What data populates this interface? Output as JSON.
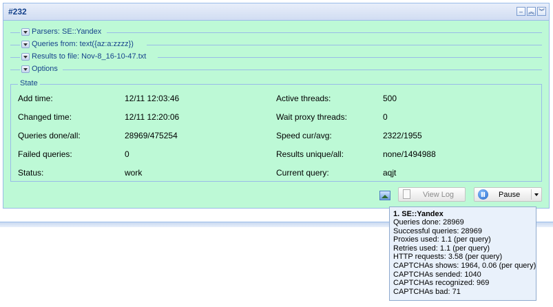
{
  "panel": {
    "title": "#232"
  },
  "fieldsets": [
    {
      "label": "Parsers: SE::Yandex"
    },
    {
      "label": "Queries from: text({az:a:zzzz})"
    },
    {
      "label": "Results to file: Nov-8_16-10-47.txt"
    },
    {
      "label": "Options"
    }
  ],
  "state": {
    "legend": "State",
    "left": [
      {
        "label": "Add time:",
        "value": "12/11 12:03:46"
      },
      {
        "label": "Changed time:",
        "value": "12/11 12:20:06"
      },
      {
        "label": "Queries done/all:",
        "value": "28969/475254"
      },
      {
        "label": "Failed queries:",
        "value": "0"
      },
      {
        "label": "Status:",
        "value": "work"
      }
    ],
    "right": [
      {
        "label": "Active threads:",
        "value": "500"
      },
      {
        "label": "Wait proxy threads:",
        "value": "0"
      },
      {
        "label": "Speed cur/avg:",
        "value": "2322/1955"
      },
      {
        "label": "Results unique/all:",
        "value": "none/1494988"
      },
      {
        "label": "Current query:",
        "value": "aqjt"
      }
    ]
  },
  "buttons": {
    "view_log": "View Log",
    "pause": "Pause"
  },
  "icons": {
    "image": "image-icon",
    "document": "document-icon",
    "pause": "pause-icon"
  },
  "tooltip": {
    "title": "1. SE::Yandex",
    "lines": [
      "Queries done: 28969",
      "Successful queries: 28969",
      "Proxies used: 1.1 (per query)",
      "Retries used: 1.1 (per query)",
      "HTTP requests: 3.58 (per query)",
      "CAPTCHAs shows: 1964, 0.06 (per query)",
      "CAPTCHAs sended: 1040",
      "CAPTCHAs recognized: 969",
      "CAPTCHAs bad: 71"
    ]
  }
}
